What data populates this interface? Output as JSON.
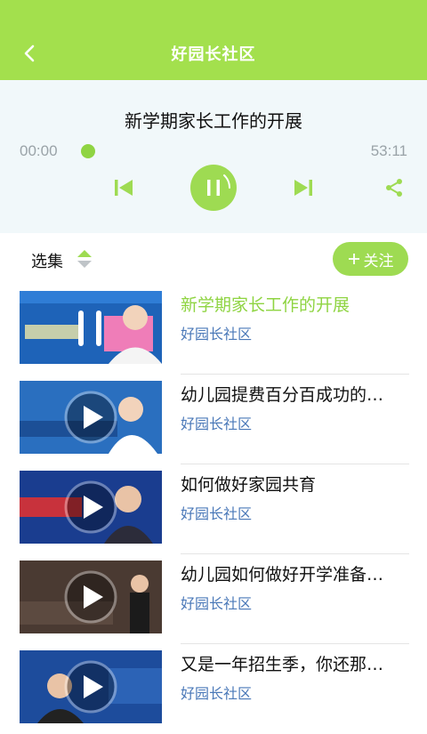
{
  "header": {
    "title": "好园长社区",
    "back_icon": "chevron-left-icon"
  },
  "player": {
    "title": "新学期家长工作的开展",
    "current_time": "00:00",
    "total_time": "53:11",
    "progress": 0,
    "accent_color": "#9edb52"
  },
  "toolbar": {
    "select_label": "选集",
    "follow_label": "关注"
  },
  "episodes": [
    {
      "title": "新学期家长工作的开展",
      "subtitle": "好园长社区",
      "active": true,
      "thumb_color": "#1e63b8"
    },
    {
      "title": "幼儿园提费百分百成功的…",
      "subtitle": "好园长社区",
      "active": false,
      "thumb_color": "#2a6fbf"
    },
    {
      "title": "如何做好家园共育",
      "subtitle": "好园长社区",
      "active": false,
      "thumb_color": "#1a3d8f"
    },
    {
      "title": "幼儿园如何做好开学准备…",
      "subtitle": "好园长社区",
      "active": false,
      "thumb_color": "#4a3a32"
    },
    {
      "title": "又是一年招生季，你还那…",
      "subtitle": "好园长社区",
      "active": false,
      "thumb_color": "#1d4c9c"
    }
  ]
}
